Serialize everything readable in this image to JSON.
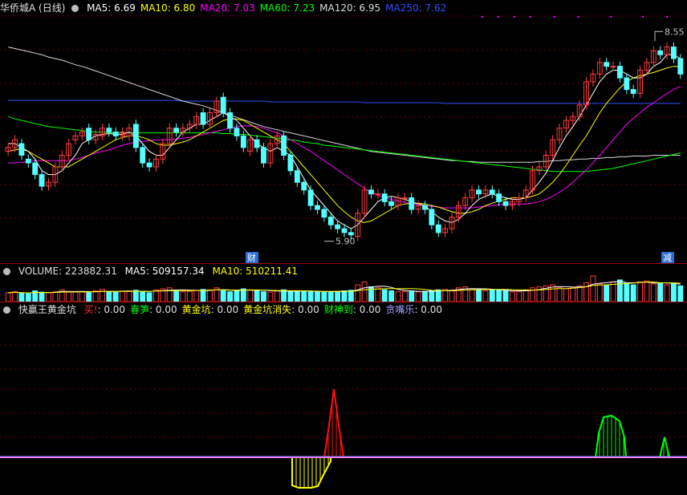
{
  "header": {
    "stock_name": "华侨城A",
    "period": "(日线)",
    "ma": [
      {
        "label": "MA5: 6.69",
        "color": "#ffffff"
      },
      {
        "label": "MA10: 6.80",
        "color": "#ffff00"
      },
      {
        "label": "MA20: 7.03",
        "color": "#ff00ff"
      },
      {
        "label": "MA60: 7.23",
        "color": "#00ff00"
      },
      {
        "label": "MA120: 6.95",
        "color": "#dcdcdc"
      },
      {
        "label": "MA250: 7.62",
        "color": "#3050ff"
      }
    ]
  },
  "price_markers": {
    "high": "8.55",
    "low": "5.90",
    "cai": "财",
    "jian": "减"
  },
  "volume_header": {
    "title": "VOLUME: 223882.31",
    "ma5": "MA5: 509157.34",
    "ma10": "MA10: 510211.41"
  },
  "indicator_header": {
    "name": "快赢王黄金坑",
    "items": [
      {
        "label": "买!",
        "value": ": 0.00",
        "color": "#ff3030"
      },
      {
        "label": "春笋",
        "value": ": 0.00",
        "color": "#00ff00"
      },
      {
        "label": "黄金坑",
        "value": ": 0.00",
        "color": "#ffff00"
      },
      {
        "label": "黄金坑消失",
        "value": ": 0.00",
        "color": "#ffff00"
      },
      {
        "label": "财神到",
        "value": ": 0.00",
        "color": "#00ff00"
      },
      {
        "label": "贪嘴乐",
        "value": ": 0.00",
        "color": "#a0a0ff"
      }
    ]
  },
  "chart_data": {
    "type": "candlestick",
    "y_range": [
      5.7,
      8.75
    ],
    "closes": [
      7.05,
      7.15,
      6.95,
      6.85,
      6.7,
      6.55,
      6.6,
      6.8,
      6.95,
      7.1,
      7.2,
      7.25,
      7.15,
      7.22,
      7.3,
      7.25,
      7.2,
      7.25,
      7.3,
      7.05,
      6.85,
      6.8,
      6.9,
      7.1,
      7.3,
      7.25,
      7.3,
      7.35,
      7.45,
      7.35,
      7.5,
      7.65,
      7.5,
      7.3,
      7.2,
      7.05,
      7.15,
      7.05,
      6.85,
      7.1,
      7.2,
      6.95,
      6.75,
      6.6,
      6.5,
      6.3,
      6.25,
      6.15,
      6.05,
      6.0,
      5.95,
      5.92,
      6.2,
      6.5,
      6.45,
      6.45,
      6.35,
      6.3,
      6.4,
      6.4,
      6.25,
      6.3,
      6.25,
      6.05,
      5.95,
      6.0,
      6.15,
      6.3,
      6.4,
      6.5,
      6.45,
      6.5,
      6.45,
      6.35,
      6.3,
      6.35,
      6.4,
      6.5,
      6.75,
      6.8,
      6.95,
      7.15,
      7.3,
      7.4,
      7.45,
      7.6,
      7.9,
      8.0,
      8.15,
      8.1,
      8.1,
      7.95,
      7.8,
      7.75,
      8.05,
      8.15,
      8.3,
      8.25,
      8.35,
      8.2,
      8.0
    ],
    "opens": [
      7.0,
      7.05,
      7.1,
      6.9,
      6.85,
      6.7,
      6.55,
      6.6,
      6.8,
      6.95,
      7.15,
      7.2,
      7.3,
      7.15,
      7.2,
      7.3,
      7.25,
      7.2,
      7.2,
      7.35,
      7.05,
      6.85,
      6.8,
      6.9,
      7.1,
      7.3,
      7.25,
      7.3,
      7.35,
      7.5,
      7.35,
      7.5,
      7.7,
      7.5,
      7.3,
      7.2,
      7.0,
      7.15,
      7.05,
      6.85,
      7.1,
      7.2,
      6.95,
      6.75,
      6.6,
      6.5,
      6.3,
      6.25,
      6.15,
      6.05,
      6.0,
      5.95,
      5.9,
      6.2,
      6.5,
      6.45,
      6.45,
      6.35,
      6.3,
      6.4,
      6.4,
      6.25,
      6.3,
      6.25,
      6.05,
      5.95,
      6.0,
      6.15,
      6.3,
      6.4,
      6.5,
      6.45,
      6.5,
      6.45,
      6.35,
      6.3,
      6.35,
      6.4,
      6.5,
      6.75,
      6.8,
      6.95,
      7.15,
      7.3,
      7.4,
      7.45,
      7.6,
      7.9,
      8.0,
      8.15,
      8.1,
      8.1,
      7.95,
      7.8,
      7.75,
      8.05,
      8.15,
      8.3,
      8.25,
      8.35,
      8.2
    ],
    "ma5": [
      7.1,
      7.1,
      7.05,
      7.0,
      6.9,
      6.75,
      6.7,
      6.7,
      6.75,
      6.85,
      6.95,
      7.1,
      7.15,
      7.2,
      7.22,
      7.23,
      7.22,
      7.22,
      7.25,
      7.2,
      7.1,
      7.0,
      6.95,
      6.95,
      7.05,
      7.15,
      7.25,
      7.3,
      7.35,
      7.35,
      7.4,
      7.45,
      7.5,
      7.45,
      7.4,
      7.3,
      7.2,
      7.1,
      7.05,
      7.0,
      7.05,
      7.0,
      6.95,
      6.8,
      6.65,
      6.5,
      6.4,
      6.3,
      6.2,
      6.1,
      6.05,
      6.0,
      6.05,
      6.15,
      6.25,
      6.35,
      6.4,
      6.42,
      6.4,
      6.38,
      6.35,
      6.32,
      6.3,
      6.22,
      6.15,
      6.1,
      6.08,
      6.12,
      6.2,
      6.3,
      6.38,
      6.42,
      6.45,
      6.42,
      6.4,
      6.38,
      6.38,
      6.4,
      6.5,
      6.6,
      6.72,
      6.88,
      7.05,
      7.2,
      7.32,
      7.45,
      7.6,
      7.75,
      7.9,
      8.0,
      8.05,
      8.05,
      8.0,
      7.95,
      7.95,
      8.0,
      8.1,
      8.15,
      8.25,
      8.25,
      8.2
    ],
    "ma10": [
      7.0,
      7.02,
      7.03,
      7.0,
      6.95,
      6.9,
      6.85,
      6.8,
      6.8,
      6.8,
      6.85,
      6.9,
      6.95,
      7.0,
      7.05,
      7.1,
      7.15,
      7.18,
      7.2,
      7.2,
      7.18,
      7.15,
      7.1,
      7.08,
      7.08,
      7.1,
      7.12,
      7.15,
      7.2,
      7.25,
      7.3,
      7.35,
      7.4,
      7.42,
      7.42,
      7.4,
      7.35,
      7.3,
      7.25,
      7.2,
      7.15,
      7.1,
      7.0,
      6.9,
      6.8,
      6.7,
      6.6,
      6.5,
      6.4,
      6.3,
      6.22,
      6.15,
      6.1,
      6.08,
      6.1,
      6.15,
      6.2,
      6.25,
      6.3,
      6.32,
      6.33,
      6.33,
      6.32,
      6.3,
      6.28,
      6.25,
      6.22,
      6.2,
      6.2,
      6.22,
      6.25,
      6.3,
      6.33,
      6.36,
      6.38,
      6.4,
      6.4,
      6.4,
      6.42,
      6.45,
      6.52,
      6.6,
      6.7,
      6.82,
      6.95,
      7.08,
      7.2,
      7.35,
      7.5,
      7.62,
      7.72,
      7.82,
      7.9,
      7.95,
      7.98,
      8.0,
      8.02,
      8.05,
      8.08,
      8.1,
      8.1
    ],
    "ma20": [
      6.85,
      6.85,
      6.86,
      6.87,
      6.88,
      6.88,
      6.88,
      6.88,
      6.88,
      6.88,
      6.9,
      6.92,
      6.95,
      6.98,
      7.0,
      7.02,
      7.05,
      7.08,
      7.1,
      7.12,
      7.13,
      7.14,
      7.15,
      7.15,
      7.15,
      7.16,
      7.17,
      7.18,
      7.2,
      7.22,
      7.24,
      7.26,
      7.28,
      7.3,
      7.32,
      7.33,
      7.33,
      7.32,
      7.3,
      7.27,
      7.24,
      7.2,
      7.15,
      7.1,
      7.05,
      7.0,
      6.94,
      6.88,
      6.82,
      6.76,
      6.7,
      6.64,
      6.58,
      6.52,
      6.47,
      6.43,
      6.4,
      6.38,
      6.36,
      6.34,
      6.32,
      6.31,
      6.3,
      6.29,
      6.28,
      6.27,
      6.27,
      6.27,
      6.27,
      6.27,
      6.28,
      6.29,
      6.3,
      6.31,
      6.32,
      6.32,
      6.32,
      6.32,
      6.33,
      6.35,
      6.38,
      6.42,
      6.47,
      6.53,
      6.6,
      6.68,
      6.76,
      6.85,
      6.95,
      7.05,
      7.15,
      7.25,
      7.35,
      7.43,
      7.5,
      7.57,
      7.63,
      7.69,
      7.75,
      7.8,
      7.84
    ],
    "ma60": [
      7.45,
      7.42,
      7.4,
      7.38,
      7.36,
      7.34,
      7.32,
      7.31,
      7.3,
      7.29,
      7.28,
      7.27,
      7.26,
      7.25,
      7.25,
      7.24,
      7.24,
      7.24,
      7.24,
      7.24,
      7.24,
      7.24,
      7.24,
      7.24,
      7.24,
      7.24,
      7.24,
      7.24,
      7.24,
      7.24,
      7.24,
      7.24,
      7.23,
      7.23,
      7.22,
      7.22,
      7.21,
      7.2,
      7.19,
      7.18,
      7.17,
      7.16,
      7.15,
      7.14,
      7.12,
      7.11,
      7.1,
      7.08,
      7.07,
      7.06,
      7.05,
      7.04,
      7.03,
      7.02,
      7.01,
      7.0,
      6.99,
      6.98,
      6.97,
      6.96,
      6.95,
      6.94,
      6.93,
      6.92,
      6.91,
      6.9,
      6.89,
      6.88,
      6.87,
      6.86,
      6.85,
      6.84,
      6.83,
      6.82,
      6.81,
      6.8,
      6.79,
      6.78,
      6.77,
      6.76,
      6.75,
      6.74,
      6.74,
      6.74,
      6.74,
      6.74,
      6.74,
      6.75,
      6.76,
      6.77,
      6.78,
      6.8,
      6.82,
      6.84,
      6.86,
      6.88,
      6.9,
      6.92,
      6.94,
      6.96,
      6.98
    ],
    "ma120": [
      8.35,
      8.33,
      8.31,
      8.29,
      8.27,
      8.25,
      8.22,
      8.2,
      8.18,
      8.15,
      8.12,
      8.1,
      8.07,
      8.04,
      8.01,
      7.98,
      7.95,
      7.92,
      7.89,
      7.86,
      7.83,
      7.8,
      7.77,
      7.74,
      7.71,
      7.68,
      7.65,
      7.63,
      7.61,
      7.59,
      7.56,
      7.53,
      7.5,
      7.47,
      7.44,
      7.41,
      7.38,
      7.35,
      7.32,
      7.3,
      7.28,
      7.26,
      7.24,
      7.22,
      7.2,
      7.18,
      7.16,
      7.14,
      7.12,
      7.1,
      7.08,
      7.06,
      7.04,
      7.02,
      7.0,
      6.99,
      6.98,
      6.97,
      6.96,
      6.95,
      6.94,
      6.93,
      6.92,
      6.91,
      6.9,
      6.89,
      6.88,
      6.88,
      6.87,
      6.87,
      6.86,
      6.86,
      6.86,
      6.86,
      6.86,
      6.86,
      6.86,
      6.86,
      6.86,
      6.87,
      6.87,
      6.88,
      6.88,
      6.89,
      6.89,
      6.9,
      6.9,
      6.91,
      6.91,
      6.92,
      6.92,
      6.93,
      6.93,
      6.94,
      6.94,
      6.94,
      6.95,
      6.95,
      6.95,
      6.95,
      6.95
    ],
    "ma250": [
      7.66,
      7.66,
      7.66,
      7.66,
      7.66,
      7.66,
      7.66,
      7.66,
      7.66,
      7.66,
      7.66,
      7.66,
      7.66,
      7.66,
      7.66,
      7.66,
      7.66,
      7.66,
      7.66,
      7.66,
      7.66,
      7.66,
      7.66,
      7.66,
      7.66,
      7.66,
      7.65,
      7.65,
      7.65,
      7.65,
      7.65,
      7.65,
      7.65,
      7.65,
      7.65,
      7.65,
      7.65,
      7.65,
      7.65,
      7.64,
      7.64,
      7.64,
      7.64,
      7.64,
      7.64,
      7.64,
      7.64,
      7.64,
      7.64,
      7.64,
      7.64,
      7.64,
      7.64,
      7.63,
      7.63,
      7.63,
      7.63,
      7.63,
      7.63,
      7.63,
      7.63,
      7.63,
      7.63,
      7.63,
      7.63,
      7.62,
      7.62,
      7.62,
      7.62,
      7.62,
      7.62,
      7.62,
      7.62,
      7.62,
      7.62,
      7.62,
      7.62,
      7.62,
      7.62,
      7.62,
      7.62,
      7.62,
      7.62,
      7.62,
      7.62,
      7.62,
      7.62,
      7.62,
      7.62,
      7.62,
      7.62,
      7.62,
      7.62,
      7.62,
      7.62,
      7.62,
      7.62,
      7.62,
      7.62,
      7.62,
      7.62
    ],
    "volume": [
      0.45,
      0.5,
      0.42,
      0.4,
      0.55,
      0.48,
      0.45,
      0.5,
      0.6,
      0.52,
      0.48,
      0.5,
      0.45,
      0.55,
      0.62,
      0.5,
      0.48,
      0.52,
      0.55,
      0.58,
      0.5,
      0.45,
      0.6,
      0.65,
      0.7,
      0.55,
      0.5,
      0.52,
      0.58,
      0.62,
      0.6,
      0.7,
      0.55,
      0.5,
      0.58,
      0.65,
      0.6,
      0.55,
      0.5,
      0.48,
      0.55,
      0.6,
      0.52,
      0.5,
      0.55,
      0.52,
      0.5,
      0.48,
      0.5,
      0.52,
      0.55,
      0.58,
      0.85,
      1.0,
      0.75,
      0.7,
      0.6,
      0.55,
      0.5,
      0.52,
      0.55,
      0.5,
      0.52,
      0.55,
      0.6,
      0.62,
      0.58,
      0.7,
      0.75,
      0.65,
      0.6,
      0.55,
      0.6,
      0.58,
      0.55,
      0.5,
      0.52,
      0.6,
      0.7,
      0.75,
      0.8,
      0.85,
      0.72,
      0.65,
      0.7,
      0.8,
      0.95,
      1.3,
      0.9,
      0.85,
      1.0,
      1.1,
      0.95,
      0.85,
      1.0,
      1.05,
      0.9,
      0.95,
      0.85,
      0.9,
      0.8
    ],
    "yellow_pit": [
      [
        364,
        570
      ],
      [
        364,
        605
      ],
      [
        372,
        608
      ],
      [
        380,
        608
      ],
      [
        388,
        608
      ],
      [
        396,
        606
      ],
      [
        404,
        590
      ],
      [
        412,
        575
      ],
      [
        412,
        570
      ]
    ],
    "red_spike": [
      [
        404,
        570
      ],
      [
        410,
        530
      ],
      [
        416,
        485
      ],
      [
        422,
        530
      ],
      [
        428,
        570
      ]
    ],
    "green_hump1": [
      [
        742,
        570
      ],
      [
        746,
        540
      ],
      [
        752,
        520
      ],
      [
        762,
        518
      ],
      [
        772,
        525
      ],
      [
        778,
        545
      ],
      [
        780,
        570
      ]
    ],
    "green_hump2": [
      [
        822,
        570
      ],
      [
        828,
        545
      ],
      [
        834,
        570
      ]
    ]
  }
}
